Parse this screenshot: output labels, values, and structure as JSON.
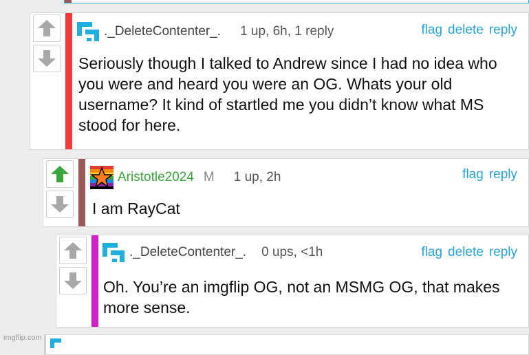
{
  "comments": [
    {
      "username": "._DeleteContenter_.",
      "meta": "1 up, 6h, 1 reply",
      "actions": [
        "flag",
        "delete",
        "reply"
      ],
      "text": "Seriously though I talked to Andrew since I had no idea who you were and heard you were an OG. Whats your old username? It kind of startled me you didn’t know what MS stood for here.",
      "bar_color": "#f23a3a",
      "upvoted": false
    },
    {
      "username": "Aristotle2024",
      "badge": "M",
      "meta": "1 up, 2h",
      "actions": [
        "flag",
        "reply"
      ],
      "text": "I am RayCat",
      "bar_color": "#9b5a5a",
      "upvoted": true
    },
    {
      "username": "._DeleteContenter_.",
      "meta": "0 ups, <1h",
      "actions": [
        "flag",
        "delete",
        "reply"
      ],
      "text": "Oh. You’re an imgflip OG, not an MSMG OG, that makes more sense.",
      "bar_color": "#d21fc8",
      "upvoted": false
    }
  ],
  "colors": {
    "link": "#2aa3d8",
    "upvote_active": "#3ca63c",
    "arrow_inactive": "#a8a8a8",
    "logo": "#1faede"
  },
  "watermark": "imgflip.com"
}
